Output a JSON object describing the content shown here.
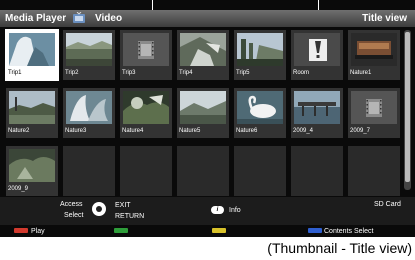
{
  "header": {
    "app_title": "Media Player",
    "section": "Video",
    "view_mode": "Title view"
  },
  "grid": {
    "items": [
      {
        "label": "Trip1",
        "thumb": "trip1",
        "selected": true
      },
      {
        "label": "Trip2",
        "thumb": "trip2"
      },
      {
        "label": "Trip3",
        "thumb": "film"
      },
      {
        "label": "Trip4",
        "thumb": "trip4"
      },
      {
        "label": "Trip5",
        "thumb": "trip5"
      },
      {
        "label": "Room",
        "thumb": "error"
      },
      {
        "label": "Nature1",
        "thumb": "nature1"
      },
      {
        "label": "Nature2",
        "thumb": "nature2"
      },
      {
        "label": "Nature3",
        "thumb": "nature3"
      },
      {
        "label": "Nature4",
        "thumb": "nature4"
      },
      {
        "label": "Nature5",
        "thumb": "nature5"
      },
      {
        "label": "Nature6",
        "thumb": "swan"
      },
      {
        "label": "2009_4",
        "thumb": "pier"
      },
      {
        "label": "2009_7",
        "thumb": "film"
      },
      {
        "label": "2009_9",
        "thumb": "nature9"
      }
    ],
    "empty_slots": 6
  },
  "bottom": {
    "access": "Access",
    "select": "Select",
    "exit": "EXIT",
    "return": "RETURN",
    "info": "Info",
    "info_icon": "i",
    "sd_card": "SD Card"
  },
  "color_buttons": {
    "red_label": "Play",
    "blue_label": "Contents Select",
    "colors": {
      "red": "#d23a2e",
      "green": "#2e9e3a",
      "yellow": "#d8c22a",
      "blue": "#2f5fd0"
    }
  },
  "caption": "(Thumbnail - Title view)"
}
